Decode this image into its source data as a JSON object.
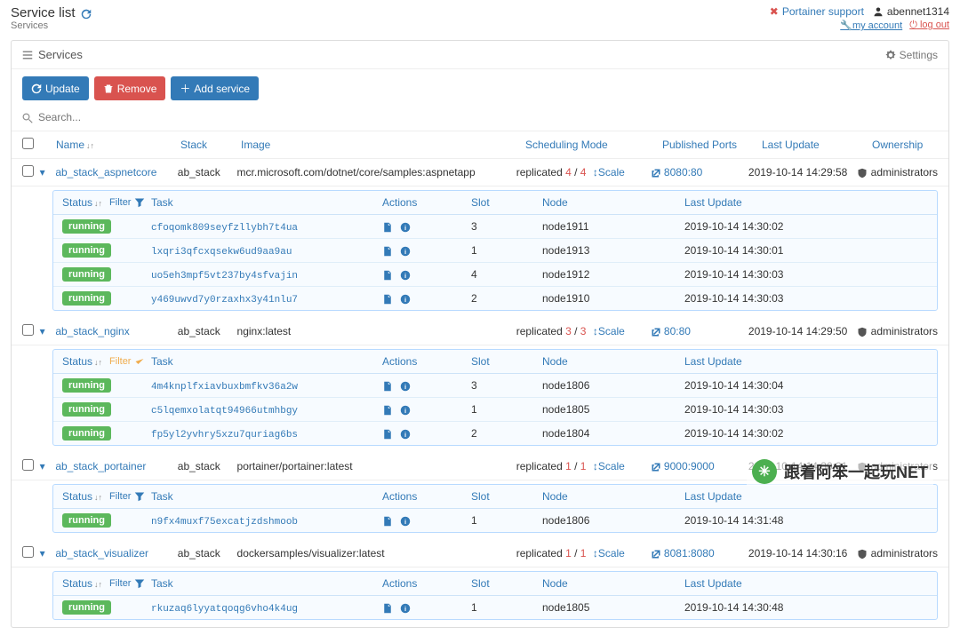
{
  "header": {
    "title": "Service list",
    "breadcrumb": "Services",
    "support": "Portainer support",
    "username": "abennet1314",
    "my_account": "my account",
    "logout": "log out"
  },
  "panel": {
    "title": "Services",
    "settings": "Settings"
  },
  "toolbar": {
    "update": "Update",
    "remove": "Remove",
    "add": "Add service"
  },
  "search": {
    "placeholder": "Search..."
  },
  "columns": {
    "name": "Name",
    "stack": "Stack",
    "image": "Image",
    "sched": "Scheduling Mode",
    "ports": "Published Ports",
    "update": "Last Update",
    "owner": "Ownership"
  },
  "taskColumns": {
    "status": "Status",
    "filter": "Filter",
    "task": "Task",
    "actions": "Actions",
    "slot": "Slot",
    "node": "Node",
    "update": "Last Update"
  },
  "labels": {
    "replicated": "replicated",
    "scale": "Scale",
    "running": "running",
    "administrators": "administrators"
  },
  "services": [
    {
      "name": "ab_stack_aspnetcore",
      "stack": "ab_stack",
      "image": "mcr.microsoft.com/dotnet/core/samples:aspnetapp",
      "replicas_cur": "4",
      "replicas_tot": "4",
      "ports": "8080:80",
      "update": "2019-10-14 14:29:58",
      "filterActive": false,
      "tasks": [
        {
          "id": "cfoqomk809seyfzllybh7t4ua",
          "slot": "3",
          "node": "node1911",
          "update": "2019-10-14 14:30:02"
        },
        {
          "id": "lxqri3qfcxqsekw6ud9aa9au",
          "slot": "1",
          "node": "node1913",
          "update": "2019-10-14 14:30:01"
        },
        {
          "id": "uo5eh3mpf5vt237by4sfvajin",
          "slot": "4",
          "node": "node1912",
          "update": "2019-10-14 14:30:03"
        },
        {
          "id": "y469uwvd7y0rzaxhx3y41nlu7",
          "slot": "2",
          "node": "node1910",
          "update": "2019-10-14 14:30:03"
        }
      ]
    },
    {
      "name": "ab_stack_nginx",
      "stack": "ab_stack",
      "image": "nginx:latest",
      "replicas_cur": "3",
      "replicas_tot": "3",
      "ports": "80:80",
      "update": "2019-10-14 14:29:50",
      "filterActive": true,
      "tasks": [
        {
          "id": "4m4knplfxiavbuxbmfkv36a2w",
          "slot": "3",
          "node": "node1806",
          "update": "2019-10-14 14:30:04"
        },
        {
          "id": "c5lqemxolatqt94966utmhbgy",
          "slot": "1",
          "node": "node1805",
          "update": "2019-10-14 14:30:03"
        },
        {
          "id": "fp5yl2yvhry5xzu7quriag6bs",
          "slot": "2",
          "node": "node1804",
          "update": "2019-10-14 14:30:02"
        }
      ]
    },
    {
      "name": "ab_stack_portainer",
      "stack": "ab_stack",
      "image": "portainer/portainer:latest",
      "replicas_cur": "1",
      "replicas_tot": "1",
      "ports": "9000:9000",
      "update": "2019-10-14 14:30:31",
      "filterActive": false,
      "tasks": [
        {
          "id": "n9fx4muxf75excatjzdshmoob",
          "slot": "1",
          "node": "node1806",
          "update": "2019-10-14 14:31:48"
        }
      ]
    },
    {
      "name": "ab_stack_visualizer",
      "stack": "ab_stack",
      "image": "dockersamples/visualizer:latest",
      "replicas_cur": "1",
      "replicas_tot": "1",
      "ports": "8081:8080",
      "update": "2019-10-14 14:30:16",
      "filterActive": false,
      "tasks": [
        {
          "id": "rkuzaq6lyyatqoqg6vho4k4ug",
          "slot": "1",
          "node": "node1805",
          "update": "2019-10-14 14:30:48"
        }
      ]
    }
  ],
  "watermark": "跟着阿笨一起玩NET"
}
